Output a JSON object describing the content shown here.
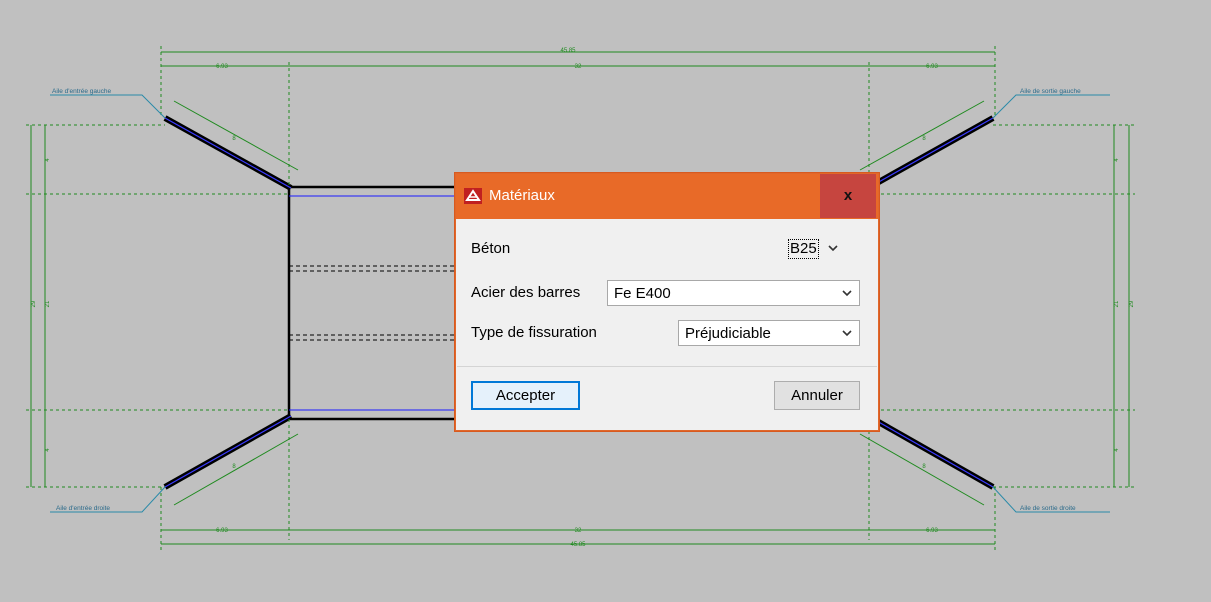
{
  "drawing": {
    "labels": {
      "top_left": "Aile d'entrée gauche",
      "top_right": "Aile de sortie gauche",
      "bottom_left": "Aile d'entrée droite",
      "bottom_right": "Aile de sortie droite"
    },
    "dims": {
      "total_top": "45.85",
      "left_span": "6.93",
      "mid_span": "32",
      "right_span": "6.93",
      "total_bottom": "45.85",
      "wing": "8",
      "side_total": "29",
      "side_inner": "21",
      "side_small": "4"
    },
    "colors": {
      "dimension": "#1f8a1f",
      "structure": "#000000",
      "axis": "#1a1aff",
      "background": "#c0c0c0"
    }
  },
  "dialog": {
    "title": "Matériaux",
    "close_icon": "close-x",
    "beton_label": "Béton",
    "beton_value": "B25",
    "acier_label": "Acier des barres",
    "acier_value": "Fe E400",
    "fissuration_label": "Type de fissuration",
    "fissuration_value": "Préjudiciable",
    "accept_label": "Accepter",
    "cancel_label": "Annuler",
    "title_color": "#e86a28",
    "close_color": "#c6453f"
  }
}
